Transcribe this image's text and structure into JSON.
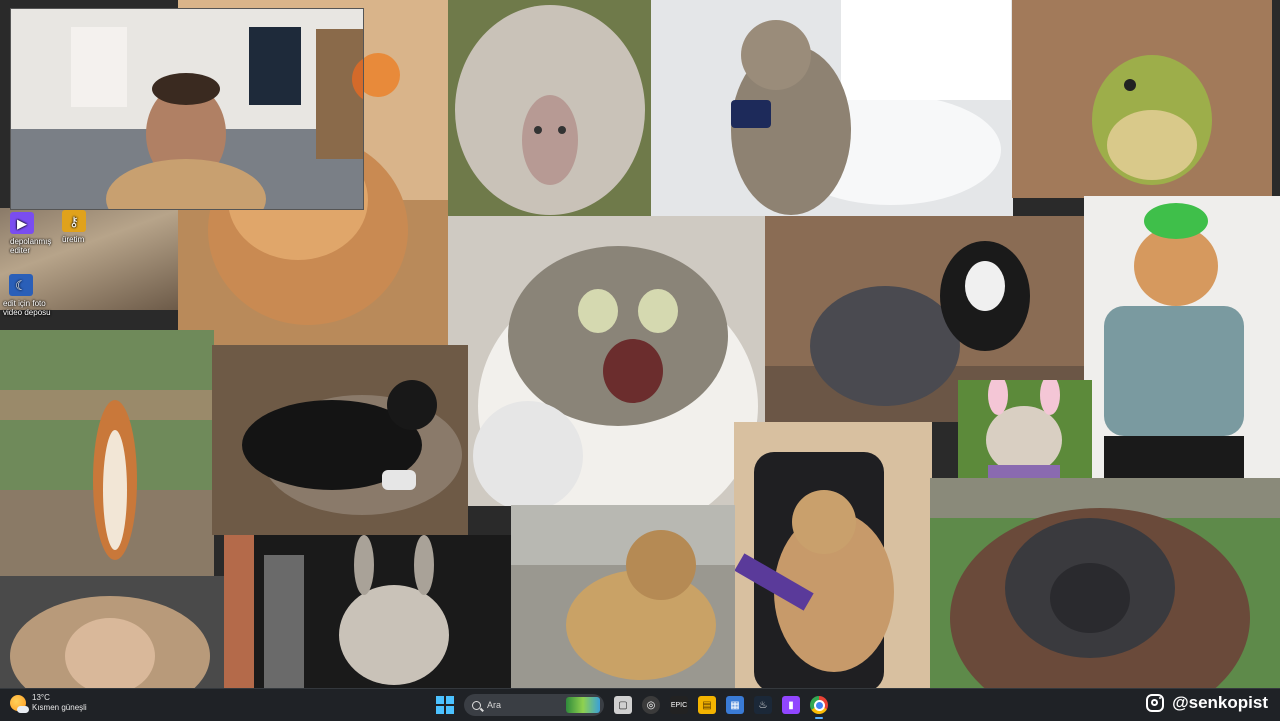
{
  "desktop": {
    "icons": [
      {
        "label": "depolanmış\nediter",
        "icon": "video-editor-icon",
        "color": "#7a4df0"
      },
      {
        "label": "üretim",
        "icon": "key-icon",
        "color": "#e0a21c"
      },
      {
        "label": "edit için foto\nvideo deposu",
        "icon": "moon-folder-icon",
        "color": "#2a5fb8"
      }
    ]
  },
  "taskbar": {
    "weather": {
      "temp": "13°C",
      "desc": "Kısmen güneşli",
      "icon": "partly-sunny-icon"
    },
    "search_placeholder": "Ara",
    "apps": [
      {
        "name": "task-view-icon",
        "color": "#d0d0d0"
      },
      {
        "name": "obs-icon",
        "color": "#3b3b3b"
      },
      {
        "name": "epic-games-icon",
        "color": "#222"
      },
      {
        "name": "file-explorer-icon",
        "color": "#f4b400"
      },
      {
        "name": "store-icon",
        "color": "#3a7bd5"
      },
      {
        "name": "steam-icon",
        "color": "#1b2838"
      },
      {
        "name": "twitch-icon",
        "color": "#9146ff"
      },
      {
        "name": "chrome-icon",
        "color": "#e94235"
      }
    ],
    "instagram_handle": "@senkopist"
  },
  "collage": {
    "tiles": [
      {
        "name": "orange-cat-tile",
        "subject": "orange cat"
      },
      {
        "name": "curly-sheep-tile",
        "subject": "curly sheep"
      },
      {
        "name": "toilet-cat-tile",
        "subject": "cat on toilet with phone"
      },
      {
        "name": "frog-tile",
        "subject": "frog in sand"
      },
      {
        "name": "cat-in-hat-tile",
        "subject": "cat wearing green hat"
      },
      {
        "name": "desktop-background-tile",
        "subject": "desktop"
      },
      {
        "name": "shocked-cat-tile",
        "subject": "screaming cat"
      },
      {
        "name": "dogs-fighting-tile",
        "subject": "dog and cat"
      },
      {
        "name": "bunny-bulldog-tile",
        "subject": "bulldog with bunny ears"
      },
      {
        "name": "squirrel-tile",
        "subject": "squirrel"
      },
      {
        "name": "black-dog-tile",
        "subject": "black dog gamer"
      },
      {
        "name": "gamer-cat-tile",
        "subject": "gamer cat with keyboard"
      },
      {
        "name": "orangutan-tile",
        "subject": "orangutan"
      },
      {
        "name": "monkey-tile",
        "subject": "monkey"
      },
      {
        "name": "donkey-tile",
        "subject": "donkey"
      },
      {
        "name": "street-dog-tile",
        "subject": "street dog"
      }
    ]
  }
}
